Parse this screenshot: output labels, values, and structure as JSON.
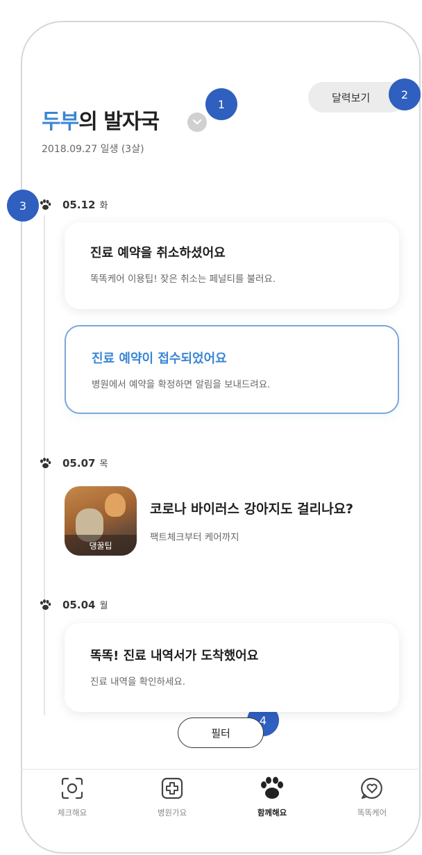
{
  "header": {
    "pet_name": "두부",
    "title_suffix": "의 발자국",
    "birth_info": "2018.09.27 일생 (3살)",
    "calendar_button": "달력보기"
  },
  "markers": [
    "1",
    "2",
    "3",
    "4"
  ],
  "timeline": [
    {
      "date": "05.12",
      "weekday": "화",
      "cards": [
        {
          "title": "진료 예약을 취소하셨어요",
          "subtitle": "똑똑케어 이용팁! 잦은 취소는 페널티를 불러요."
        },
        {
          "title": "진료 예약이 접수되었어요",
          "subtitle": "병원에서 예약을 확정하면 알림을 보내드려요."
        }
      ]
    },
    {
      "date": "05.07",
      "weekday": "목",
      "article": {
        "tag": "댕꿀팁",
        "title": "코로나 바이러스 강아지도 걸리나요?",
        "subtitle": "팩트체크부터 케어까지"
      }
    },
    {
      "date": "05.04",
      "weekday": "월",
      "cards": [
        {
          "title": "똑똑! 진료 내역서가 도착했어요",
          "subtitle": "진료 내역을 확인하세요."
        }
      ]
    }
  ],
  "filter_button": "필터",
  "bottom_nav": [
    {
      "label": "체크해요",
      "icon": "scan-icon"
    },
    {
      "label": "병원가요",
      "icon": "hospital-cross-icon"
    },
    {
      "label": "함께해요",
      "icon": "paw-icon"
    },
    {
      "label": "똑똑케어",
      "icon": "heart-chat-icon"
    }
  ],
  "colors": {
    "accent": "#3a86d4",
    "marker": "#2f5fbf"
  }
}
